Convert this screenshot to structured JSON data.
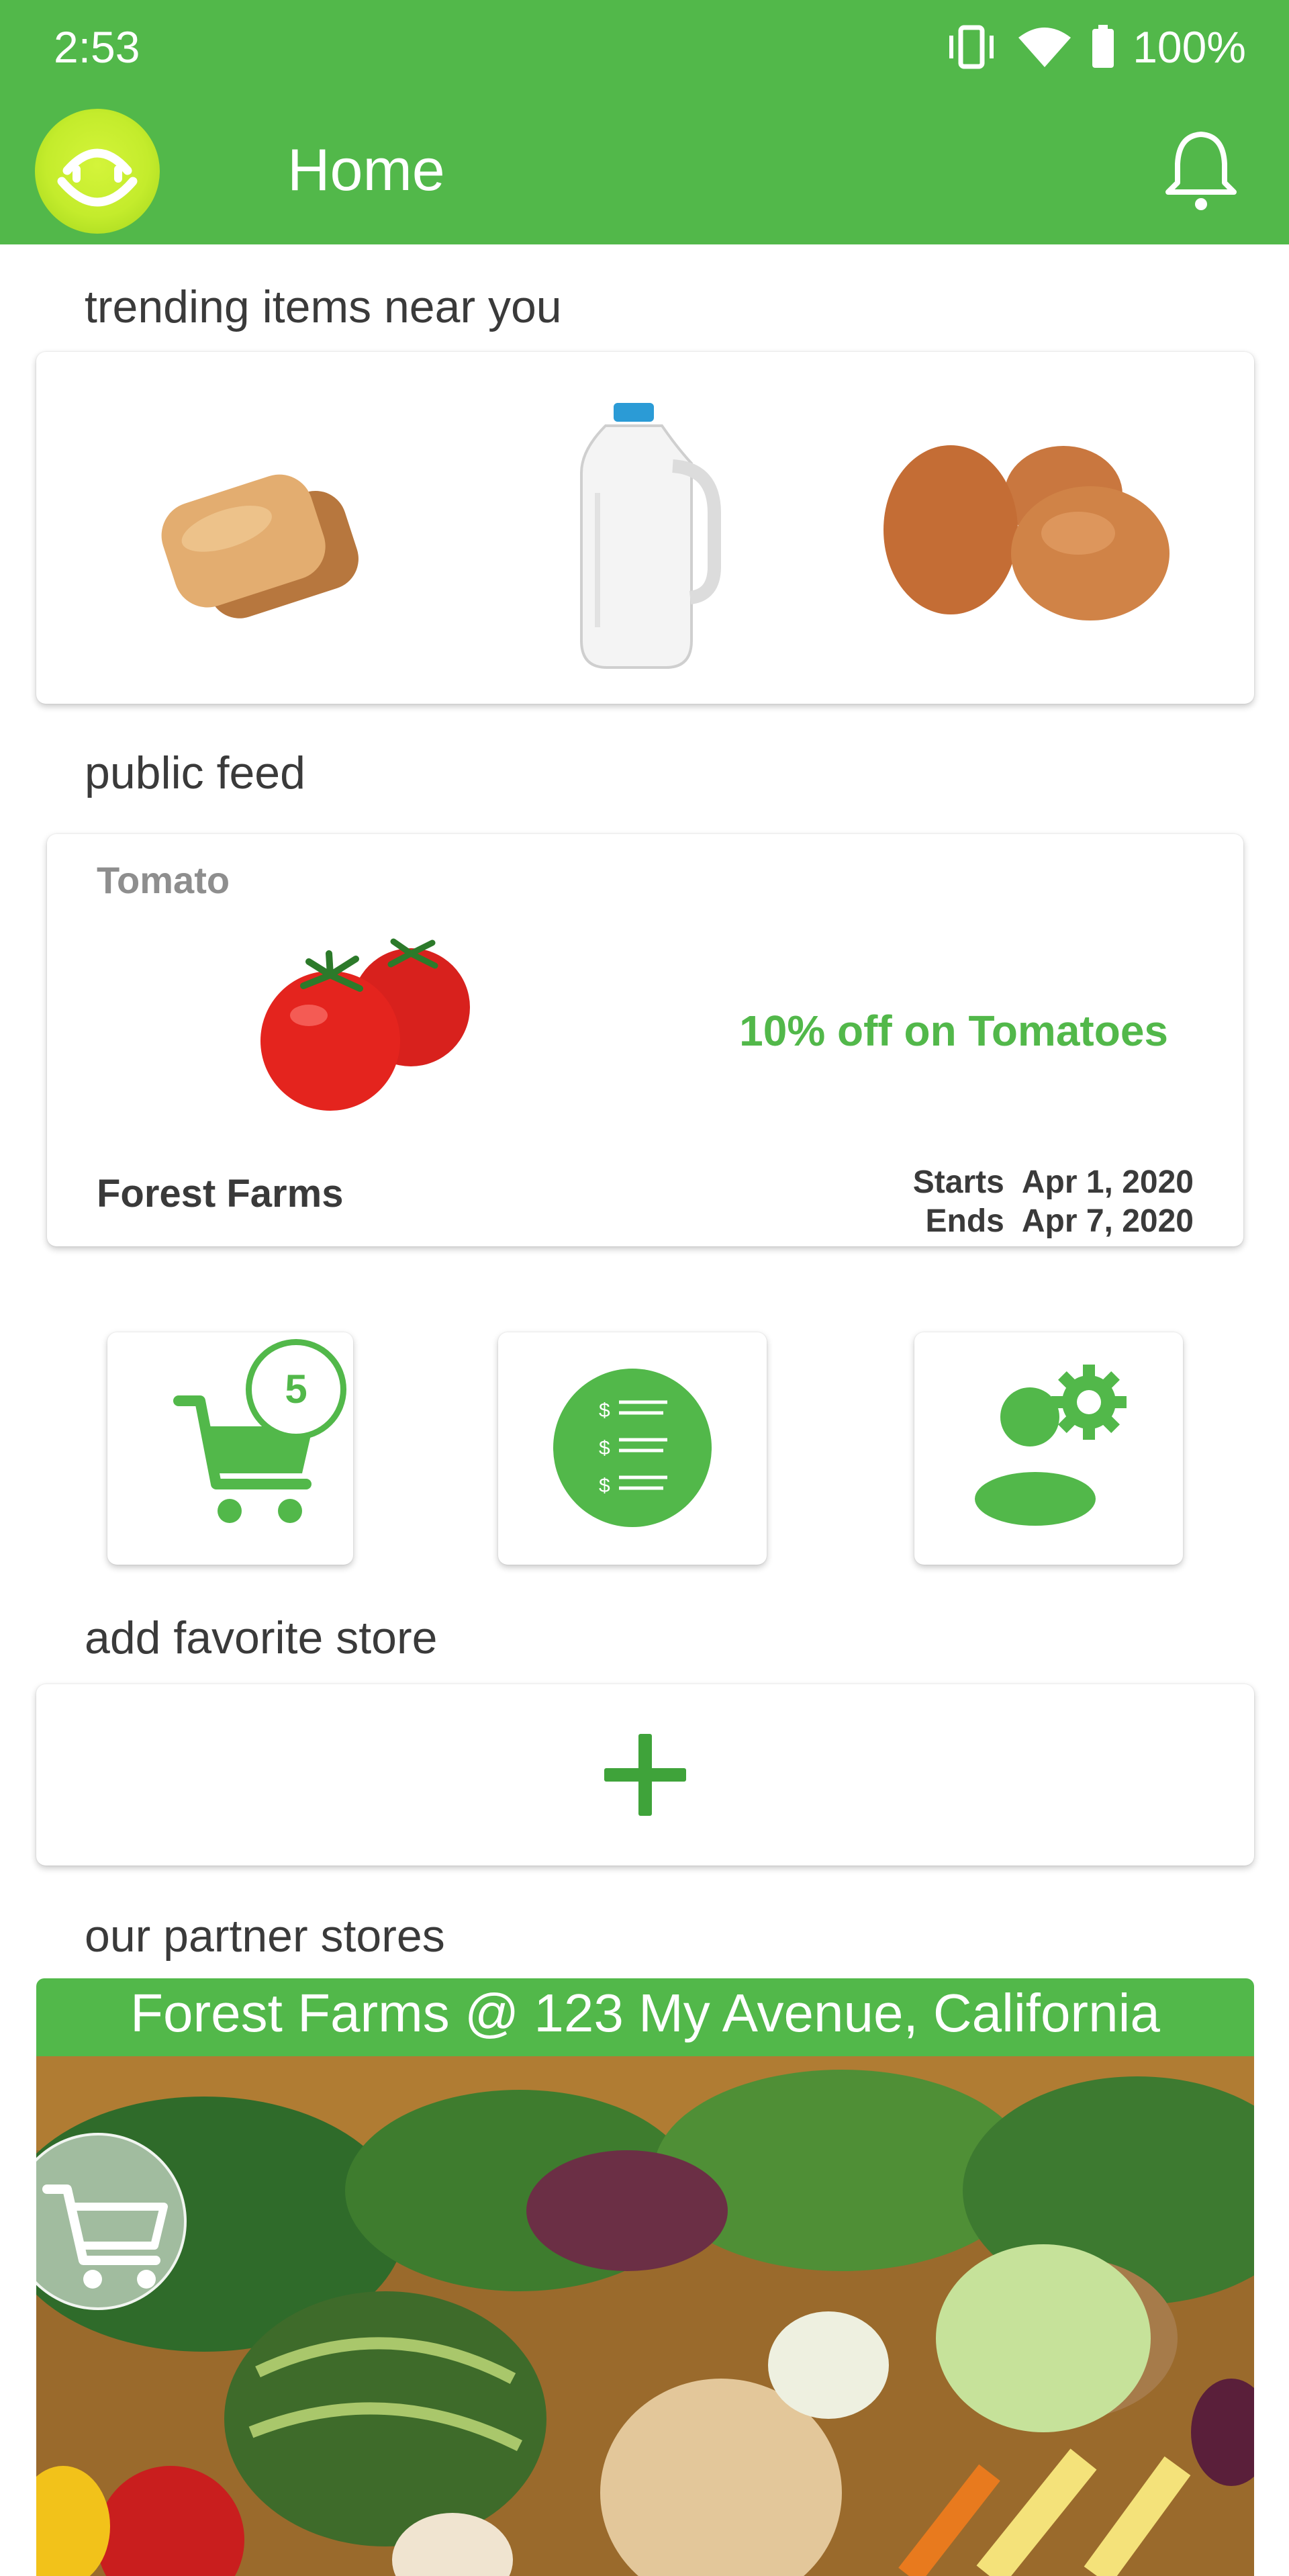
{
  "status_bar": {
    "time": "2:53",
    "battery": "100%",
    "icons": [
      "vibrate-icon",
      "wifi-icon",
      "battery-icon"
    ]
  },
  "app_bar": {
    "title": "Home",
    "logo": "smiley-basket-logo",
    "notification_icon": "bell-icon"
  },
  "trending": {
    "title": "trending items near you",
    "items": [
      "bread-image",
      "milk-jug-image",
      "eggs-image"
    ]
  },
  "feed": {
    "title": "public feed",
    "post": {
      "category": "Tomato",
      "offer": "10% off on Tomatoes",
      "store": "Forest Farms",
      "starts_label": "Starts",
      "starts_date": "Apr 1, 2020",
      "ends_label": "Ends",
      "ends_date": "Apr 7, 2020"
    }
  },
  "quick_actions": {
    "cart_count": "5",
    "icons": [
      "cart-icon",
      "price-list-icon",
      "profile-settings-icon"
    ]
  },
  "favorite_store": {
    "title": "add favorite store",
    "icon": "plus-icon"
  },
  "partner_stores": {
    "title": "our partner stores",
    "stores": [
      {
        "name": "Forest Farms @ 123 My Avenue, California"
      }
    ]
  },
  "colors": {
    "primary_green": "#52b84a",
    "logo_yellow": "#c4ec2c",
    "text_dark": "#3a3a3a",
    "text_muted": "#8e8e8e"
  }
}
